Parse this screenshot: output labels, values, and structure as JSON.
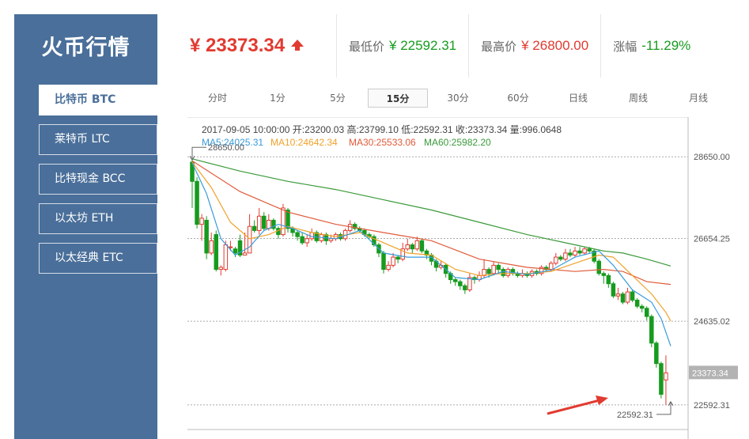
{
  "sidebar": {
    "title": "火币行情",
    "items": [
      {
        "label": "比特币 BTC",
        "active": true
      },
      {
        "label": "莱特币 LTC",
        "active": false
      },
      {
        "label": "比特现金 BCC",
        "active": false
      },
      {
        "label": "以太坊 ETH",
        "active": false
      },
      {
        "label": "以太经典 ETC",
        "active": false
      }
    ]
  },
  "ticker": {
    "price": "¥ 23373.34",
    "low_label": "最低价",
    "low_value": "¥ 22592.31",
    "high_label": "最高价",
    "high_value": "¥ 26800.00",
    "change_label": "涨幅",
    "change_value": "-11.29%"
  },
  "tabs": [
    "分时",
    "1分",
    "5分",
    "15分",
    "30分",
    "60分",
    "日线",
    "周线",
    "月线"
  ],
  "active_tab": "15分",
  "colors": {
    "up": "#e23a30",
    "down": "#169b1e",
    "sidebar_bg": "#4a6f9a",
    "ma5": "#3a9bd9",
    "ma10": "#f0a22a",
    "ma30": "#e05a3a",
    "ma60": "#3a9a3a"
  },
  "chart_data": {
    "type": "candlestick",
    "info_line": "2017-09-05 10:00:00  开:23200.03 高:23799.10 低:22592.31 收:23373.34 量:996.0648",
    "ma_legend": [
      {
        "name": "MA5:24025.31",
        "color": "#3a9bd9"
      },
      {
        "name": "MA10:24642.34",
        "color": "#f0a22a"
      },
      {
        "name": "MA30:25533.06",
        "color": "#e05a3a"
      },
      {
        "name": "MA60:25982.20",
        "color": "#3a9a3a"
      }
    ],
    "y_ticks": [
      28650.0,
      26654.25,
      24635.02,
      22592.31
    ],
    "y_tick_labels": [
      "28650.00",
      "26654.25",
      "24635.02",
      "22592.31"
    ],
    "ylim": [
      21990,
      29620
    ],
    "last_price_label": "23373.34",
    "last_price": 23373.34,
    "max_annotation": {
      "label": "28650.00",
      "value": 28650.0,
      "index": 0
    },
    "min_annotation": {
      "label": "22592.31",
      "value": 22592.31,
      "index": 100
    },
    "candles": [
      [
        28520,
        28050,
        28650,
        27400
      ],
      [
        28050,
        27000,
        28150,
        26900
      ],
      [
        27000,
        27150,
        27250,
        26600
      ],
      [
        27100,
        26300,
        27200,
        26150
      ],
      [
        26300,
        26600,
        26800,
        26250
      ],
      [
        26750,
        25900,
        26850,
        25850
      ],
      [
        25900,
        25950,
        26000,
        25750
      ],
      [
        25900,
        26500,
        26600,
        25850
      ],
      [
        26450,
        26450,
        26600,
        26350
      ],
      [
        26400,
        26300,
        26450,
        26200
      ],
      [
        26600,
        26250,
        26750,
        26200
      ],
      [
        26250,
        26300,
        26800,
        26250
      ],
      [
        26300,
        26950,
        27250,
        26300
      ],
      [
        26950,
        26850,
        27100,
        26800
      ],
      [
        26850,
        27200,
        27400,
        26750
      ],
      [
        27200,
        26900,
        27300,
        26850
      ],
      [
        26900,
        27100,
        27250,
        26850
      ],
      [
        27100,
        26900,
        27150,
        26850
      ],
      [
        26900,
        26750,
        26950,
        26650
      ],
      [
        26750,
        27400,
        27500,
        26700
      ],
      [
        27350,
        26900,
        27400,
        26800
      ],
      [
        26900,
        26800,
        26950,
        26700
      ],
      [
        26800,
        26700,
        26850,
        26600
      ],
      [
        26700,
        26550,
        26800,
        26500
      ],
      [
        26550,
        26650,
        26750,
        26450
      ],
      [
        26650,
        26800,
        26900,
        26600
      ],
      [
        26800,
        26600,
        26850,
        26550
      ],
      [
        26600,
        26750,
        26800,
        26550
      ],
      [
        26750,
        26600,
        26800,
        26500
      ],
      [
        26600,
        26650,
        26750,
        26550
      ],
      [
        26650,
        26750,
        26800,
        26600
      ],
      [
        26750,
        26650,
        26800,
        26600
      ],
      [
        26650,
        26850,
        26900,
        26600
      ],
      [
        26850,
        27000,
        27100,
        26800
      ],
      [
        27000,
        26900,
        27050,
        26850
      ],
      [
        26900,
        26850,
        26950,
        26800
      ],
      [
        26850,
        26750,
        26900,
        26700
      ],
      [
        26750,
        26700,
        26800,
        26650
      ],
      [
        26700,
        26500,
        26750,
        26450
      ],
      [
        26500,
        26300,
        26550,
        26200
      ],
      [
        26300,
        25900,
        26350,
        25800
      ],
      [
        25900,
        26000,
        26100,
        25850
      ],
      [
        26000,
        26200,
        26300,
        25950
      ],
      [
        26200,
        26150,
        26250,
        26050
      ],
      [
        26150,
        26400,
        26550,
        26100
      ],
      [
        26400,
        26500,
        26650,
        26350
      ],
      [
        26500,
        26400,
        26550,
        26300
      ],
      [
        26400,
        26600,
        26700,
        26350
      ],
      [
        26600,
        26350,
        26650,
        26300
      ],
      [
        26350,
        26250,
        26400,
        26150
      ],
      [
        26250,
        26100,
        26300,
        26000
      ],
      [
        26100,
        25950,
        26150,
        25850
      ],
      [
        25950,
        26000,
        26100,
        25900
      ],
      [
        26000,
        25800,
        26050,
        25700
      ],
      [
        25800,
        25650,
        25850,
        25550
      ],
      [
        25650,
        25600,
        25700,
        25500
      ],
      [
        25600,
        25500,
        25650,
        25400
      ],
      [
        25500,
        25400,
        25550,
        25300
      ],
      [
        25400,
        25700,
        25800,
        25350
      ],
      [
        25700,
        25650,
        25750,
        25550
      ],
      [
        25650,
        25750,
        25850,
        25600
      ],
      [
        25750,
        25900,
        26150,
        25700
      ],
      [
        25900,
        25800,
        25950,
        25700
      ],
      [
        25800,
        26000,
        26100,
        25750
      ],
      [
        26000,
        25900,
        26050,
        25800
      ],
      [
        25900,
        25750,
        25950,
        25700
      ],
      [
        25750,
        25900,
        25950,
        25700
      ],
      [
        25900,
        25800,
        25950,
        25750
      ],
      [
        25800,
        25750,
        25850,
        25700
      ],
      [
        25750,
        25800,
        25900,
        25700
      ],
      [
        25800,
        25750,
        25850,
        25700
      ],
      [
        25750,
        25850,
        25900,
        25700
      ],
      [
        25850,
        25800,
        25900,
        25750
      ],
      [
        25800,
        25950,
        26000,
        25750
      ],
      [
        25950,
        25900,
        26000,
        25850
      ],
      [
        25900,
        26050,
        26100,
        25850
      ],
      [
        26050,
        26200,
        26300,
        26000
      ],
      [
        26200,
        26150,
        26250,
        26100
      ],
      [
        26150,
        26300,
        26400,
        26100
      ],
      [
        26300,
        26250,
        26400,
        26200
      ],
      [
        26250,
        26350,
        26450,
        26200
      ],
      [
        26350,
        26300,
        26450,
        26250
      ],
      [
        26300,
        26400,
        26450,
        26250
      ],
      [
        26400,
        26350,
        26450,
        26300
      ],
      [
        26350,
        26100,
        26400,
        26050
      ],
      [
        26100,
        25800,
        26150,
        25750
      ],
      [
        25800,
        25750,
        25850,
        25550
      ],
      [
        25750,
        25550,
        25800,
        25450
      ],
      [
        25550,
        25250,
        25600,
        25200
      ],
      [
        25250,
        25300,
        25450,
        25150
      ],
      [
        25300,
        25100,
        25350,
        25050
      ],
      [
        25100,
        25350,
        25450,
        25050
      ],
      [
        25350,
        25150,
        25400,
        25100
      ],
      [
        25150,
        25000,
        25200,
        24950
      ],
      [
        25000,
        24950,
        25050,
        24850
      ],
      [
        24950,
        24750,
        25000,
        24650
      ],
      [
        24750,
        24100,
        24800,
        24000
      ],
      [
        24100,
        23600,
        24150,
        23500
      ],
      [
        23600,
        22850,
        23650,
        22750
      ],
      [
        23200,
        23373.34,
        23799.1,
        22592.31
      ]
    ],
    "ma5": [
      [
        0,
        28500
      ],
      [
        3,
        27750
      ],
      [
        6,
        26650
      ],
      [
        9,
        26250
      ],
      [
        12,
        26450
      ],
      [
        15,
        26850
      ],
      [
        18,
        27000
      ],
      [
        21,
        26900
      ],
      [
        25,
        26700
      ],
      [
        30,
        26650
      ],
      [
        35,
        26850
      ],
      [
        40,
        26300
      ],
      [
        45,
        26200
      ],
      [
        50,
        26200
      ],
      [
        55,
        25700
      ],
      [
        60,
        25650
      ],
      [
        65,
        25850
      ],
      [
        70,
        25780
      ],
      [
        75,
        25880
      ],
      [
        80,
        26200
      ],
      [
        85,
        26350
      ],
      [
        88,
        26000
      ],
      [
        92,
        25400
      ],
      [
        96,
        25100
      ],
      [
        98,
        24700
      ],
      [
        100,
        24025
      ]
    ],
    "ma10": [
      [
        0,
        28520
      ],
      [
        4,
        27900
      ],
      [
        8,
        27050
      ],
      [
        12,
        26650
      ],
      [
        16,
        26750
      ],
      [
        20,
        26950
      ],
      [
        25,
        26800
      ],
      [
        30,
        26700
      ],
      [
        35,
        26800
      ],
      [
        40,
        26550
      ],
      [
        45,
        26300
      ],
      [
        50,
        26250
      ],
      [
        55,
        25900
      ],
      [
        60,
        25750
      ],
      [
        65,
        25800
      ],
      [
        70,
        25800
      ],
      [
        75,
        25850
      ],
      [
        80,
        26050
      ],
      [
        85,
        26250
      ],
      [
        88,
        26200
      ],
      [
        92,
        25750
      ],
      [
        96,
        25300
      ],
      [
        99,
        24850
      ],
      [
        100,
        24642
      ]
    ],
    "ma30": [
      [
        0,
        28550
      ],
      [
        10,
        27800
      ],
      [
        20,
        27300
      ],
      [
        30,
        27000
      ],
      [
        40,
        26800
      ],
      [
        50,
        26600
      ],
      [
        60,
        26150
      ],
      [
        70,
        25950
      ],
      [
        80,
        25850
      ],
      [
        86,
        25900
      ],
      [
        90,
        25850
      ],
      [
        95,
        25600
      ],
      [
        100,
        25533
      ]
    ],
    "ma60": [
      [
        0,
        28600
      ],
      [
        10,
        28300
      ],
      [
        20,
        28050
      ],
      [
        30,
        27850
      ],
      [
        40,
        27600
      ],
      [
        50,
        27350
      ],
      [
        60,
        27050
      ],
      [
        70,
        26750
      ],
      [
        80,
        26500
      ],
      [
        86,
        26350
      ],
      [
        90,
        26300
      ],
      [
        95,
        26150
      ],
      [
        100,
        25982
      ]
    ]
  }
}
